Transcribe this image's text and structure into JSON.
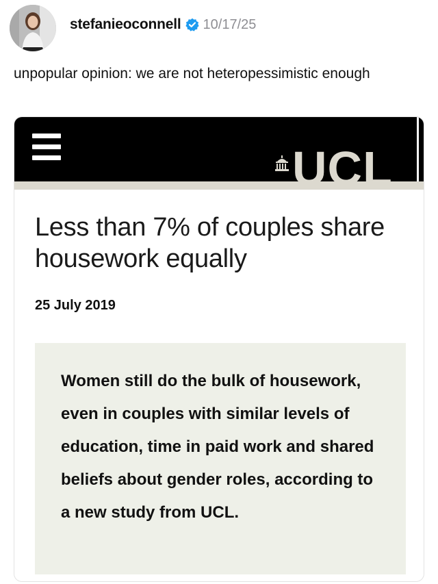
{
  "post": {
    "username": "stefanieoconnell",
    "verified_icon": "verified-badge-icon",
    "timestamp": "10/17/25",
    "caption": "unpopular opinion: we are not heteropessimistic enough",
    "accent_color": "#1d9bf0"
  },
  "article": {
    "brand": "UCL",
    "menu_icon": "hamburger-menu-icon",
    "headline": "Less than 7% of couples share housework equally",
    "date": "25 July 2019",
    "summary": "Women still do the bulk of housework, even in couples with similar levels of education, time in paid work and shared beliefs about gender roles, according to a new study from UCL.",
    "colors": {
      "header_bg": "#000000",
      "brand_stone": "#dcd9cf",
      "quote_bg": "#eef0e8"
    }
  }
}
